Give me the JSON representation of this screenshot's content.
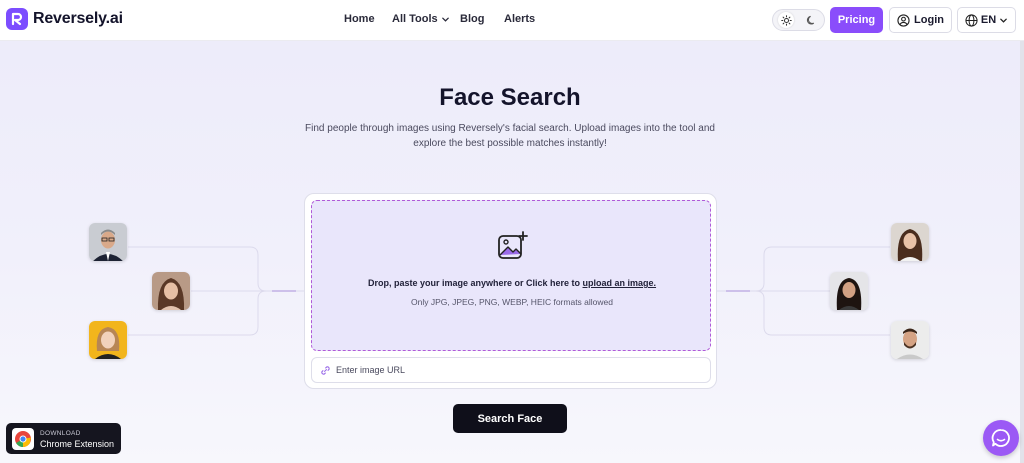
{
  "brand": {
    "name": "Reversely.ai",
    "accent": "#8a4dfb",
    "logo_color": "#7c4dff"
  },
  "nav": {
    "home": "Home",
    "all_tools": "All Tools",
    "blog": "Blog",
    "alerts": "Alerts"
  },
  "header_actions": {
    "theme_light_icon": "sun-icon",
    "theme_dark_icon": "moon-icon",
    "pricing": "Pricing",
    "login": "Login",
    "language": "EN"
  },
  "hero": {
    "title": "Face Search",
    "description": "Find people through images using Reversely's facial search. Upload images into the tool and explore the best possible matches instantly!"
  },
  "upload": {
    "drop_text": "Drop, paste your image anywhere or Click here to ",
    "drop_link": "upload an image.",
    "formats": "Only JPG, JPEG, PNG, WEBP, HEIC formats allowed",
    "url_placeholder": "Enter image URL"
  },
  "search_button": "Search Face",
  "extension": {
    "small": "DOWNLOAD",
    "big": "Chrome Extension"
  },
  "colors": {
    "dropzone_bg": "#e9e6fb",
    "dropzone_border": "#b05ad8",
    "search_button_bg": "#0f0f1a",
    "chat_bg": "#9b59f5"
  }
}
